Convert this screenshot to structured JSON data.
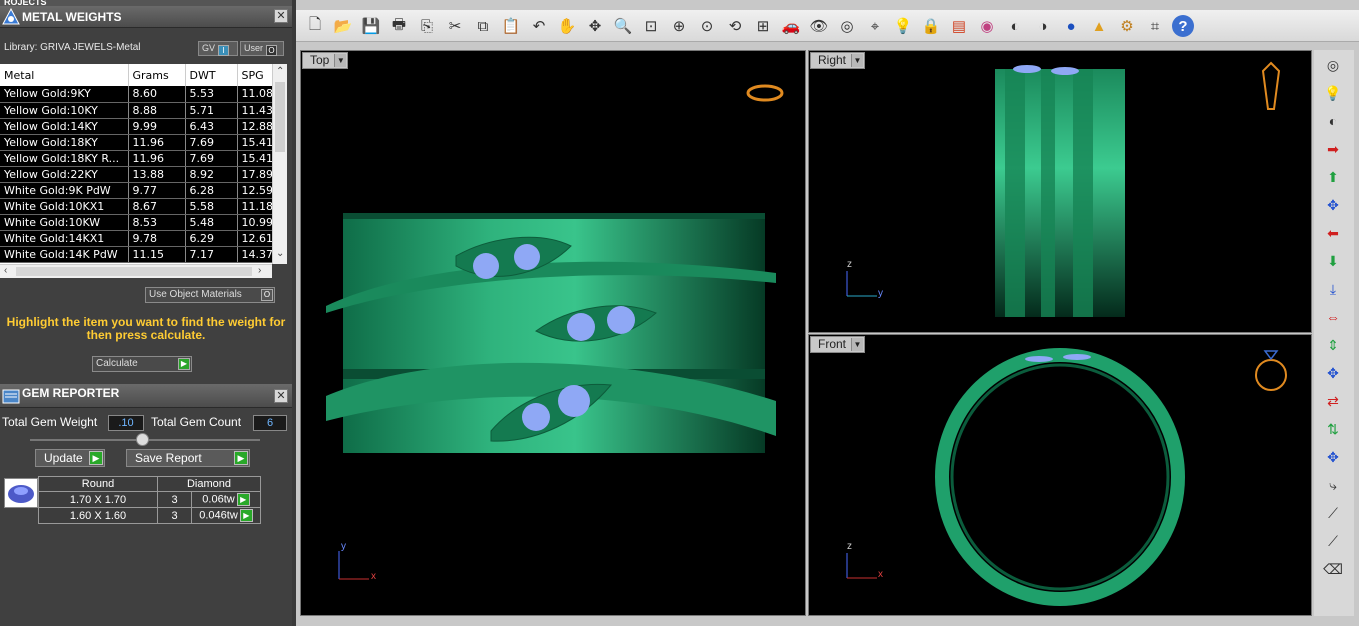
{
  "top_sliver_text": "ROJECTS",
  "metal_panel": {
    "title": "METAL WEIGHTS",
    "close": "✕",
    "library_label": "Library: GRIVA JEWELS-Metal",
    "gv_label": "GV",
    "gv_state": "I",
    "user_label": "User",
    "user_state": "O",
    "columns": [
      "Metal",
      "Grams",
      "DWT",
      "SPG"
    ],
    "rows": [
      [
        "Yellow Gold:9KY",
        "8.60",
        "5.53",
        "11.08"
      ],
      [
        "Yellow Gold:10KY",
        "8.88",
        "5.71",
        "11.43"
      ],
      [
        "Yellow Gold:14KY",
        "9.99",
        "6.43",
        "12.88"
      ],
      [
        "Yellow Gold:18KY",
        "11.96",
        "7.69",
        "15.41"
      ],
      [
        "Yellow Gold:18KY R...",
        "11.96",
        "7.69",
        "15.41"
      ],
      [
        "Yellow Gold:22KY",
        "13.88",
        "8.92",
        "17.89"
      ],
      [
        "White Gold:9K PdW",
        "9.77",
        "6.28",
        "12.59"
      ],
      [
        "White Gold:10KX1",
        "8.67",
        "5.58",
        "11.18"
      ],
      [
        "White Gold:10KW",
        "8.53",
        "5.48",
        "10.99"
      ],
      [
        "White Gold:14KX1",
        "9.78",
        "6.29",
        "12.61"
      ],
      [
        "White Gold:14K PdW",
        "11.15",
        "7.17",
        "14.37"
      ]
    ],
    "use_object_materials": "Use Object Materials",
    "use_object_state": "O",
    "message": "Highlight the item you want to find the weight for then press calculate.",
    "calculate": "Calculate"
  },
  "gem_panel": {
    "title": "GEM REPORTER",
    "close": "✕",
    "total_weight_label": "Total Gem Weight",
    "total_weight_value": ".10",
    "total_count_label": "Total Gem Count",
    "total_count_value": "6",
    "update": "Update",
    "save_report": "Save Report",
    "columns": [
      "Round",
      "Diamond"
    ],
    "rows": [
      {
        "size": "1.70 X 1.70",
        "count": "3",
        "weight": "0.06tw"
      },
      {
        "size": "1.60 X 1.60",
        "count": "3",
        "weight": "0.046tw"
      }
    ]
  },
  "viewports": {
    "top": {
      "label": "Top",
      "x_axis": "x",
      "y_axis": "y"
    },
    "right": {
      "label": "Right",
      "z_axis": "z",
      "y_axis": "y"
    },
    "front": {
      "label": "Front",
      "z_axis": "z",
      "x_axis": "x"
    }
  },
  "toolbar_icons": [
    "new-icon",
    "open-icon",
    "save-icon",
    "print-icon",
    "copy-page-icon",
    "cut-icon",
    "copy-icon",
    "paste-icon",
    "undo-icon",
    "pan-hand-icon",
    "move-icon",
    "zoom-in-icon",
    "zoom-window-icon",
    "zoom-extents-icon",
    "zoom-target-icon",
    "rotate-view-icon",
    "four-viewports-icon",
    "car-icon",
    "eye-icon",
    "target-icon",
    "snap-icon",
    "light-bulb-icon",
    "lock-icon",
    "layers-icon",
    "color-wheel-icon",
    "shade-icon",
    "render-icon",
    "sphere-icon",
    "cone-icon",
    "settings-gear-icon",
    "crop-icon",
    "help-icon"
  ],
  "colors": {
    "accent_green": "#29a829",
    "message_yellow": "#ffcc33",
    "model_green": "#1e9a6a"
  }
}
